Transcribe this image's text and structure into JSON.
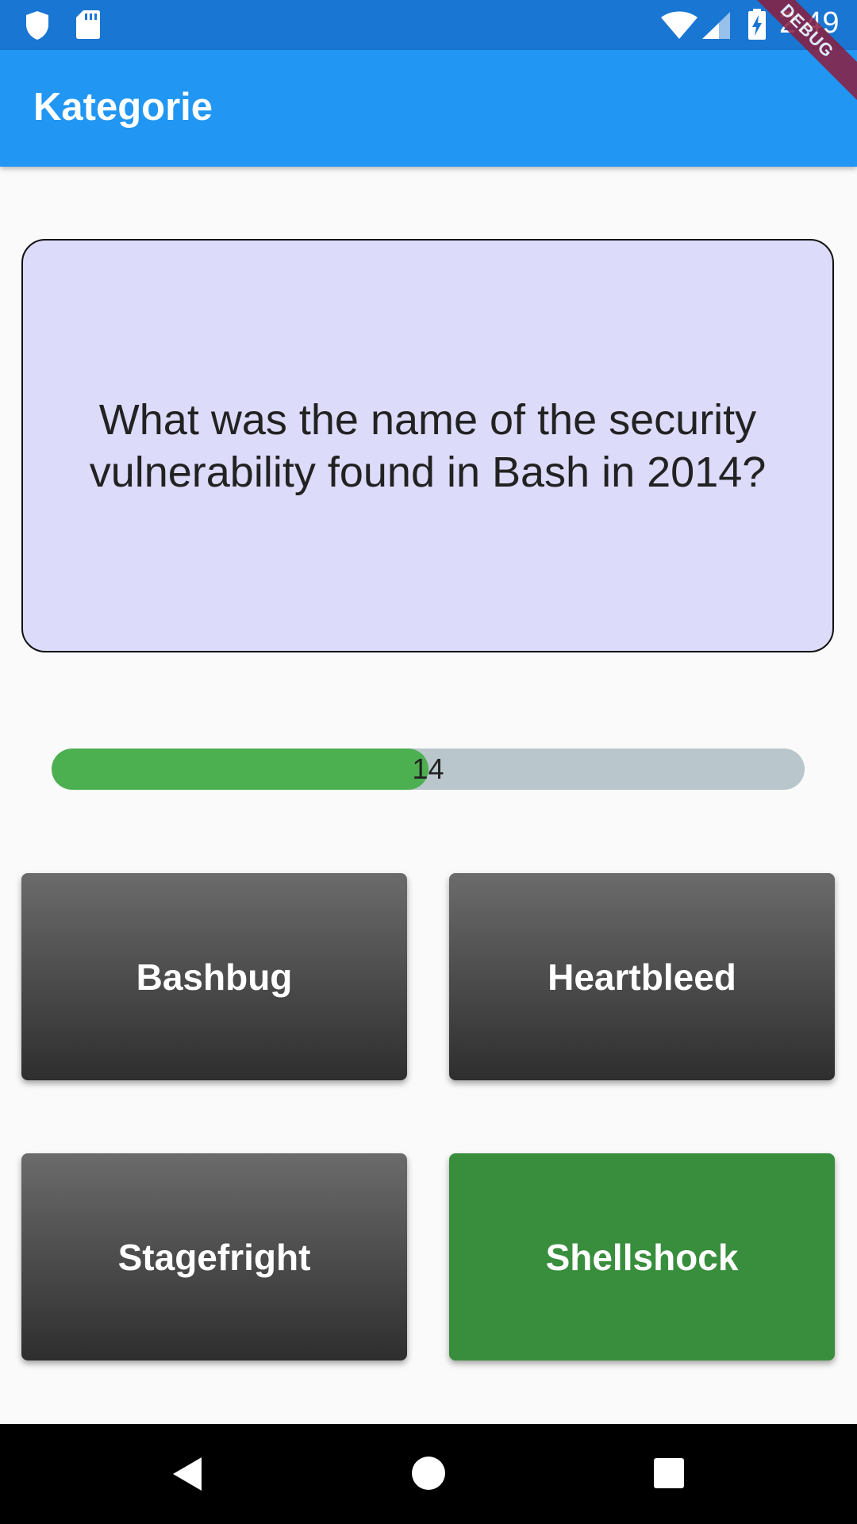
{
  "status_bar": {
    "time": "2:49",
    "icons": [
      "shield-icon",
      "sd-card-icon",
      "wifi-icon",
      "signal-icon",
      "battery-charging-icon"
    ]
  },
  "debug_banner": "DEBUG",
  "app_bar": {
    "title": "Kategorie"
  },
  "question": {
    "text": "What was the name of the security vulnerability found in Bash in 2014?"
  },
  "timer": {
    "value": "14",
    "fraction": 0.5
  },
  "answers": [
    {
      "label": "Bashbug",
      "state": "default"
    },
    {
      "label": "Heartbleed",
      "state": "default"
    },
    {
      "label": "Stagefright",
      "state": "default"
    },
    {
      "label": "Shellshock",
      "state": "correct"
    }
  ],
  "nav_bar": {
    "icons": [
      "back-icon",
      "home-icon",
      "recents-icon"
    ]
  },
  "colors": {
    "status_bar": "#1976d2",
    "app_bar": "#2196f3",
    "card": "#dddbfa",
    "progress_fill": "#4caf50",
    "progress_track": "#b9c7cc",
    "correct": "#388e3c"
  }
}
